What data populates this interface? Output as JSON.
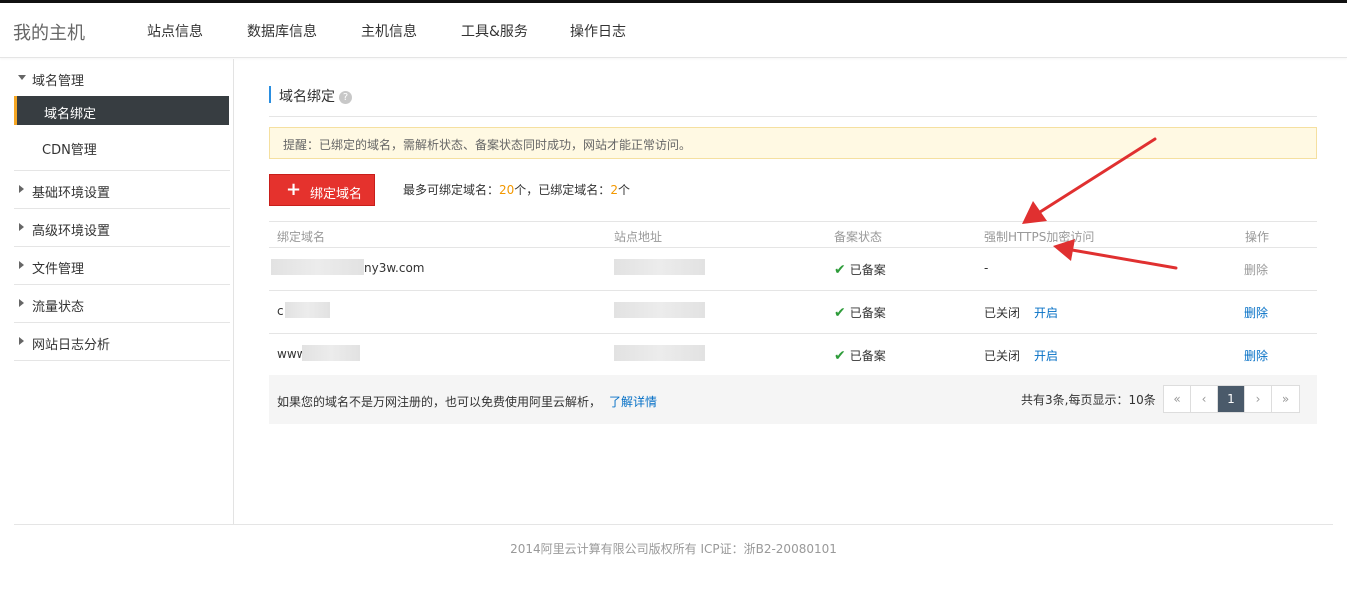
{
  "header": {
    "brand": "我的主机",
    "nav": [
      "站点信息",
      "数据库信息",
      "主机信息",
      "工具&服务",
      "操作日志"
    ]
  },
  "sidebar": {
    "domain_group": "域名管理",
    "domain_bind": "域名绑定",
    "cdn": "CDN管理",
    "groups": [
      "基础环境设置",
      "高级环境设置",
      "文件管理",
      "流量状态",
      "网站日志分析"
    ]
  },
  "main": {
    "title": "域名绑定",
    "help_glyph": "?",
    "notice": "提醒：已绑定的域名，需解析状态、备案状态同时成功，网站才能正常访问。",
    "add_button": "绑定域名",
    "add_button_glyph": "+",
    "quota_label": "最多可绑定域名：",
    "quota_max": "20",
    "quota_unit1": "个，已绑定域名：",
    "quota_bound": "2",
    "quota_unit2": "个"
  },
  "table": {
    "headers": [
      "绑定域名",
      "站点地址",
      "备案状态",
      "强制HTTPS加密访问",
      "操作"
    ],
    "rows": [
      {
        "domain": "ny3w.com",
        "status": "已备案",
        "https": "-",
        "https_action": "",
        "action": "删除"
      },
      {
        "domain": "c",
        "status": "已备案",
        "https": "已关闭",
        "https_action": "开启",
        "action": "删除"
      },
      {
        "domain": "www",
        "status": "已备案",
        "https": "已关闭",
        "https_action": "开启",
        "action": "删除"
      }
    ],
    "check_glyph": "✔"
  },
  "footer_bar": {
    "note": "如果您的域名不是万网注册的，也可以免费使用阿里云解析，",
    "link": "了解详情",
    "page_info": "共有3条,每页显示：10条",
    "pager": [
      "«",
      "‹",
      "1",
      "›",
      "»"
    ]
  },
  "copyright": "2014阿里云计算有限公司版权所有 ICP证：浙B2-20080101",
  "colors": {
    "accent_red": "#e5322d",
    "arrow_red": "#e03030",
    "link_blue": "#0570c6",
    "check_green": "#2e9c3a",
    "active_bg": "#373d41"
  }
}
